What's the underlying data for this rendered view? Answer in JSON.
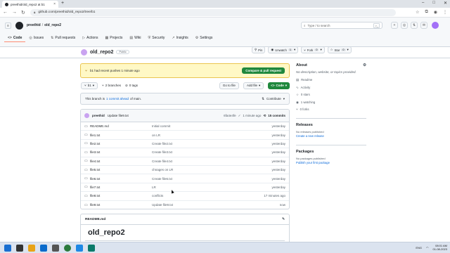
{
  "browser": {
    "tab_title": "preethid/old_repo2 at b1",
    "new_tab": "+",
    "url": "github.com/preethid/old_repo2/tree/b1",
    "win_min": "–",
    "win_max": "□",
    "win_close": "✕"
  },
  "gh": {
    "owner": "preethid",
    "sep": "/",
    "repo": "old_repo2",
    "search_placeholder": "Type / to search",
    "search_kbd": ">_",
    "nav": [
      {
        "label": "Code",
        "icon": "<>"
      },
      {
        "label": "Issues",
        "icon": "◎"
      },
      {
        "label": "Pull requests",
        "icon": "⇅"
      },
      {
        "label": "Actions",
        "icon": "▷"
      },
      {
        "label": "Projects",
        "icon": "▦"
      },
      {
        "label": "Wiki",
        "icon": "▤"
      },
      {
        "label": "Security",
        "icon": "⛨"
      },
      {
        "label": "Insights",
        "icon": "↗"
      },
      {
        "label": "Settings",
        "icon": "⚙"
      }
    ]
  },
  "repo": {
    "name": "old_repo2",
    "visibility": "Public",
    "pin": "Pin",
    "unwatch": "Unwatch",
    "watch_count": "1",
    "fork": "Fork",
    "fork_count": "0",
    "star": "Star",
    "star_count": "0"
  },
  "banner": {
    "text": "b1 had recent pushes 1 minute ago",
    "button": "Compare & pull request"
  },
  "branchbar": {
    "branch": "b1",
    "branches": "2 branches",
    "tags": "0 tags",
    "goto": "Go to file",
    "addfile": "Add file",
    "code": "Code"
  },
  "ahead": {
    "prefix": "This branch is",
    "link": "1 commit ahead",
    "suffix": "of main.",
    "contribute": "Contribute"
  },
  "latest": {
    "author": "preethid",
    "message": "Update file9.txt",
    "sha": "6fa4e4fe",
    "when": "1 minute ago",
    "commits": "15 commits"
  },
  "files": [
    {
      "name": "README.md",
      "msg": "Initial commit",
      "date": "yesterday"
    },
    {
      "name": "file1.txt",
      "msg": "on LR",
      "date": "yesterday"
    },
    {
      "name": "file2.txt",
      "msg": "Create file2.txt",
      "date": "yesterday"
    },
    {
      "name": "file3.txt",
      "msg": "Create file3.txt",
      "date": "yesterday"
    },
    {
      "name": "file4.txt",
      "msg": "Create file4.txt",
      "date": "yesterday"
    },
    {
      "name": "file5.txt",
      "msg": "chnages on LR",
      "date": "yesterday"
    },
    {
      "name": "file6.txt",
      "msg": "Create file6.txt",
      "date": "yesterday"
    },
    {
      "name": "file7.txt",
      "msg": "LR",
      "date": "yesterday"
    },
    {
      "name": "file8.txt",
      "msg": "conflicts",
      "date": "17 minutes ago"
    },
    {
      "name": "file9.txt",
      "msg": "Update file9.txt",
      "date": "now"
    }
  ],
  "readme": {
    "label": "README.md",
    "title": "old_repo2"
  },
  "about": {
    "heading": "About",
    "desc": "No description, website, or topics provided.",
    "readme": "Readme",
    "activity": "Activity",
    "stars": "0 stars",
    "watching": "1 watching",
    "forks": "0 forks"
  },
  "releases": {
    "heading": "Releases",
    "none": "No releases published",
    "link": "Create a new release"
  },
  "packages": {
    "heading": "Packages",
    "none": "No packages published",
    "link": "Publish your first package"
  },
  "taskbar": {
    "time": "08:01 AM",
    "date": "01-08-2023",
    "lang": "ENG"
  }
}
